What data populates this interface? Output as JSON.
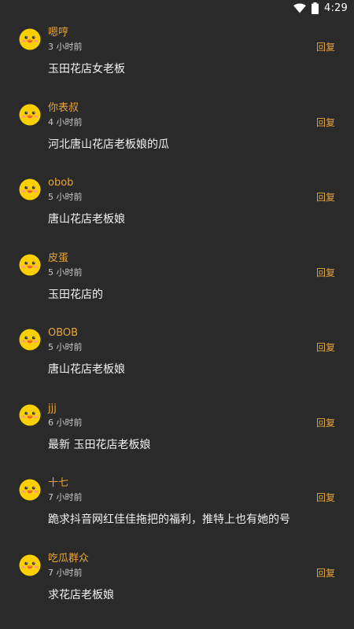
{
  "status_bar": {
    "time": "4:29",
    "icons": [
      "wifi-icon",
      "battery-icon"
    ]
  },
  "colors": {
    "background": "#2b2a2b",
    "accent": "#e7a53a",
    "text": "#f2f2f2",
    "muted": "#c9c9c9"
  },
  "comments": [
    {
      "user": "嗯哼",
      "time": "3 小时前",
      "text": "玉田花店女老板",
      "reply": "回复"
    },
    {
      "user": "你表叔",
      "time": "4 小时前",
      "text": "河北唐山花店老板娘的瓜",
      "reply": "回复"
    },
    {
      "user": "obob",
      "time": "5 小时前",
      "text": "唐山花店老板娘",
      "reply": "回复"
    },
    {
      "user": "皮蛋",
      "time": "5 小时前",
      "text": "玉田花店的",
      "reply": "回复"
    },
    {
      "user": "OBOB",
      "time": "5 小时前",
      "text": "唐山花店老板娘",
      "reply": "回复"
    },
    {
      "user": "jjj",
      "time": "6 小时前",
      "text": "最新 玉田花店老板娘",
      "reply": "回复"
    },
    {
      "user": "十七",
      "time": "7 小时前",
      "text": "跪求抖音网红佳佳拖把的福利，推特上也有她的号",
      "reply": "回复"
    },
    {
      "user": "吃瓜群众",
      "time": "7 小时前",
      "text": "求花店老板娘",
      "reply": "回复"
    }
  ]
}
